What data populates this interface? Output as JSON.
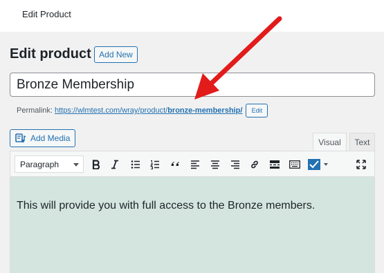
{
  "topbar": {
    "title": "Edit Product"
  },
  "page": {
    "title": "Edit product",
    "add_new_label": "Add New"
  },
  "post_title": {
    "value": "Bronze Membership"
  },
  "permalink": {
    "label": "Permalink:",
    "base_url": "https://wlmtest.com/wray/product/",
    "slug": "bronze-membership/",
    "edit_label": "Edit"
  },
  "media": {
    "add_media_label": "Add Media"
  },
  "editor_tabs": [
    {
      "label": "Visual",
      "active": true
    },
    {
      "label": "Text",
      "active": false
    }
  ],
  "toolbar": {
    "format_value": "Paragraph",
    "buttons": [
      "bold",
      "italic",
      "bulleted-list",
      "numbered-list",
      "blockquote",
      "align-left",
      "align-center",
      "align-right",
      "insert-link",
      "read-more",
      "toolbar-toggle",
      "text-color",
      "fullscreen"
    ]
  },
  "editor": {
    "content": "This will provide you with full access to the Bronze members.",
    "background_color": "#d4e5df"
  },
  "colors": {
    "accent": "#2271b1",
    "arrow": "#e21b1b"
  }
}
